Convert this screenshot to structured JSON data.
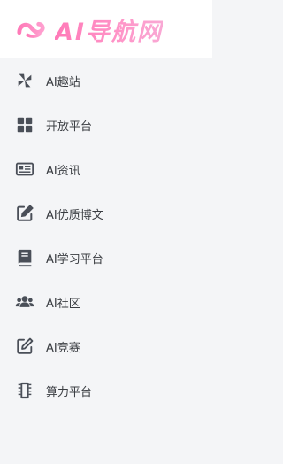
{
  "brand": {
    "name": "AI导航网",
    "color": "#ff85c0"
  },
  "sidebar": {
    "items": [
      {
        "label": "AI趣站",
        "icon": "pinwheel-icon"
      },
      {
        "label": "开放平台",
        "icon": "grid-icon"
      },
      {
        "label": "AI资讯",
        "icon": "newspaper-icon"
      },
      {
        "label": "AI优质博文",
        "icon": "edit-square-icon"
      },
      {
        "label": "AI学习平台",
        "icon": "book-icon"
      },
      {
        "label": "AI社区",
        "icon": "users-icon"
      },
      {
        "label": "AI竞赛",
        "icon": "pen-square-icon"
      },
      {
        "label": "算力平台",
        "icon": "chip-icon"
      }
    ]
  },
  "colors": {
    "icon": "#4a4f58",
    "background": "#f4f5f7",
    "header": "#ffffff"
  }
}
